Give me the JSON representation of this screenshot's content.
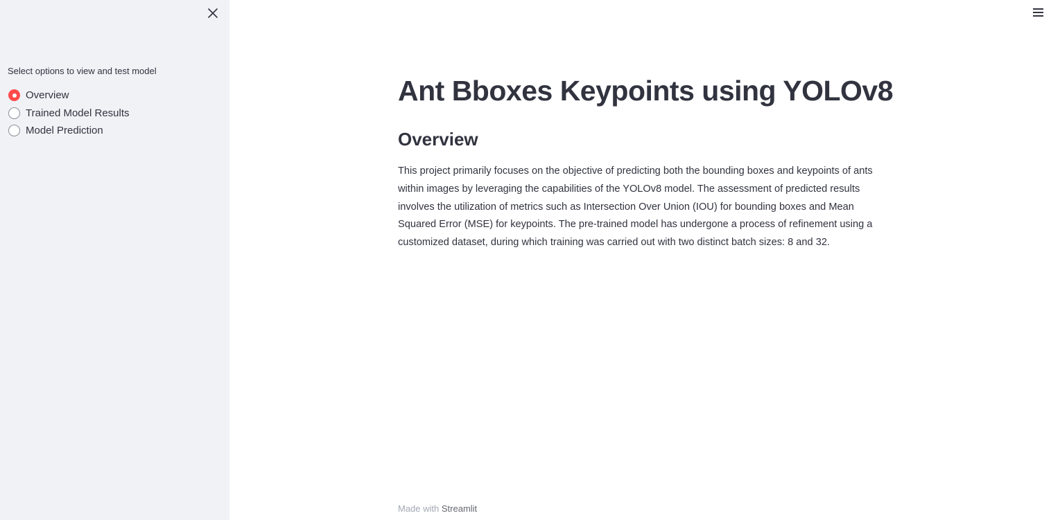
{
  "sidebar": {
    "radio_group_label": "Select options to view and test model",
    "options": [
      {
        "label": "Overview",
        "selected": true
      },
      {
        "label": "Trained Model Results",
        "selected": false
      },
      {
        "label": "Model Prediction",
        "selected": false
      }
    ],
    "close_icon": "close-icon"
  },
  "header": {
    "menu_icon": "hamburger-menu-icon"
  },
  "main": {
    "title": "Ant Bboxes Keypoints using YOLOv8",
    "section_title": "Overview",
    "paragraph": "This project primarily focuses on the objective of predicting both the bounding boxes and keypoints of ants within images by leveraging the capabilities of the YOLOv8 model. The assessment of predicted results involves the utilization of metrics such as Intersection Over Union (IOU) for bounding boxes and Mean Squared Error (MSE) for keypoints. The pre-trained model has undergone a process of refinement using a customized dataset, during which training was carried out with two distinct batch sizes: 8 and 32."
  },
  "footer": {
    "prefix": "Made with",
    "link": "Streamlit"
  },
  "colors": {
    "accent": "#ff4b4b",
    "sidebar_bg": "#f0f2f6",
    "text": "#31333f"
  }
}
